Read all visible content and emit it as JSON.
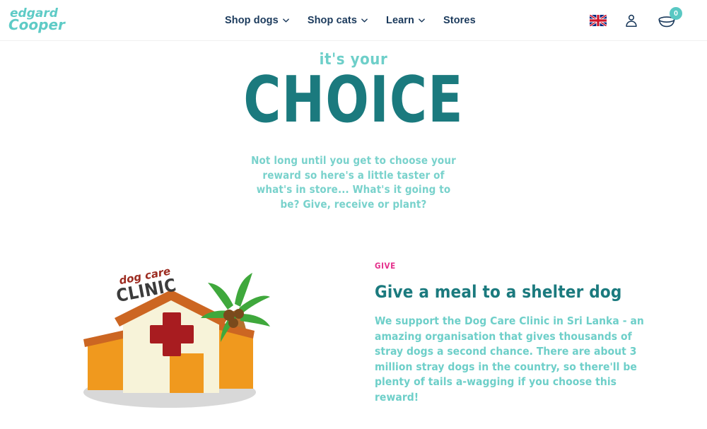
{
  "header": {
    "logo": {
      "name": "edgard-cooper-logo",
      "line1": "edgard",
      "line2": "Cooper",
      "color": "#5ecbc6"
    },
    "nav": [
      {
        "label": "Shop dogs",
        "icon": "chevron-down-icon",
        "has_chevron": true
      },
      {
        "label": "Shop cats",
        "icon": "chevron-down-icon",
        "has_chevron": true
      },
      {
        "label": "Learn",
        "icon": "chevron-down-icon",
        "has_chevron": true
      },
      {
        "label": "Stores",
        "icon": "",
        "has_chevron": false
      }
    ],
    "nav_color": "#1b3a5c",
    "actions": {
      "language": {
        "icon": "uk-flag-icon",
        "label": "United Kingdom"
      },
      "account": {
        "icon": "account-person-icon",
        "label": "Account"
      },
      "cart": {
        "icon": "dog-bowl-cart-icon",
        "label": "Cart",
        "count": "0",
        "badge_color": "#59c8c3"
      }
    }
  },
  "hero": {
    "eyebrow": "it's your",
    "title": "CHOICE",
    "subtitle": "Not long until you get to choose your reward so here's a little taster of what's in store... What's it going to be? Give, receive or plant?",
    "eyebrow_color": "#6ecfc9",
    "title_color": "#1b7a7e",
    "subtitle_color": "#79d2cc"
  },
  "reward": {
    "eyebrow": "GIVE",
    "eyebrow_color": "#e5308c",
    "title": "Give a meal to a shelter dog",
    "title_color": "#1b7a7e",
    "body": "We support the Dog Care Clinic in Sri Lanka - an amazing organisation that gives thousands of stray dogs a second chance. There are about 3 million stray dogs in the country, so there'll be plenty of tails a-wagging if you choose this reward!",
    "body_color": "#6ecfc9",
    "illustration": {
      "name": "dog-care-clinic-illustration",
      "sign_line1": "dog care",
      "sign_line2": "CLINIC",
      "sign_line1_color": "#9c2b20",
      "sign_line2_color": "#3b3b3b",
      "wall_color": "#f0991e",
      "roof_color": "#cc6622",
      "facade_color": "#f7f3d9",
      "cross_color": "#a81c20",
      "palm_leaf_color": "#3fa83c",
      "palm_trunk_color": "#b5722e",
      "shadow_color": "#c9c9c9"
    }
  }
}
